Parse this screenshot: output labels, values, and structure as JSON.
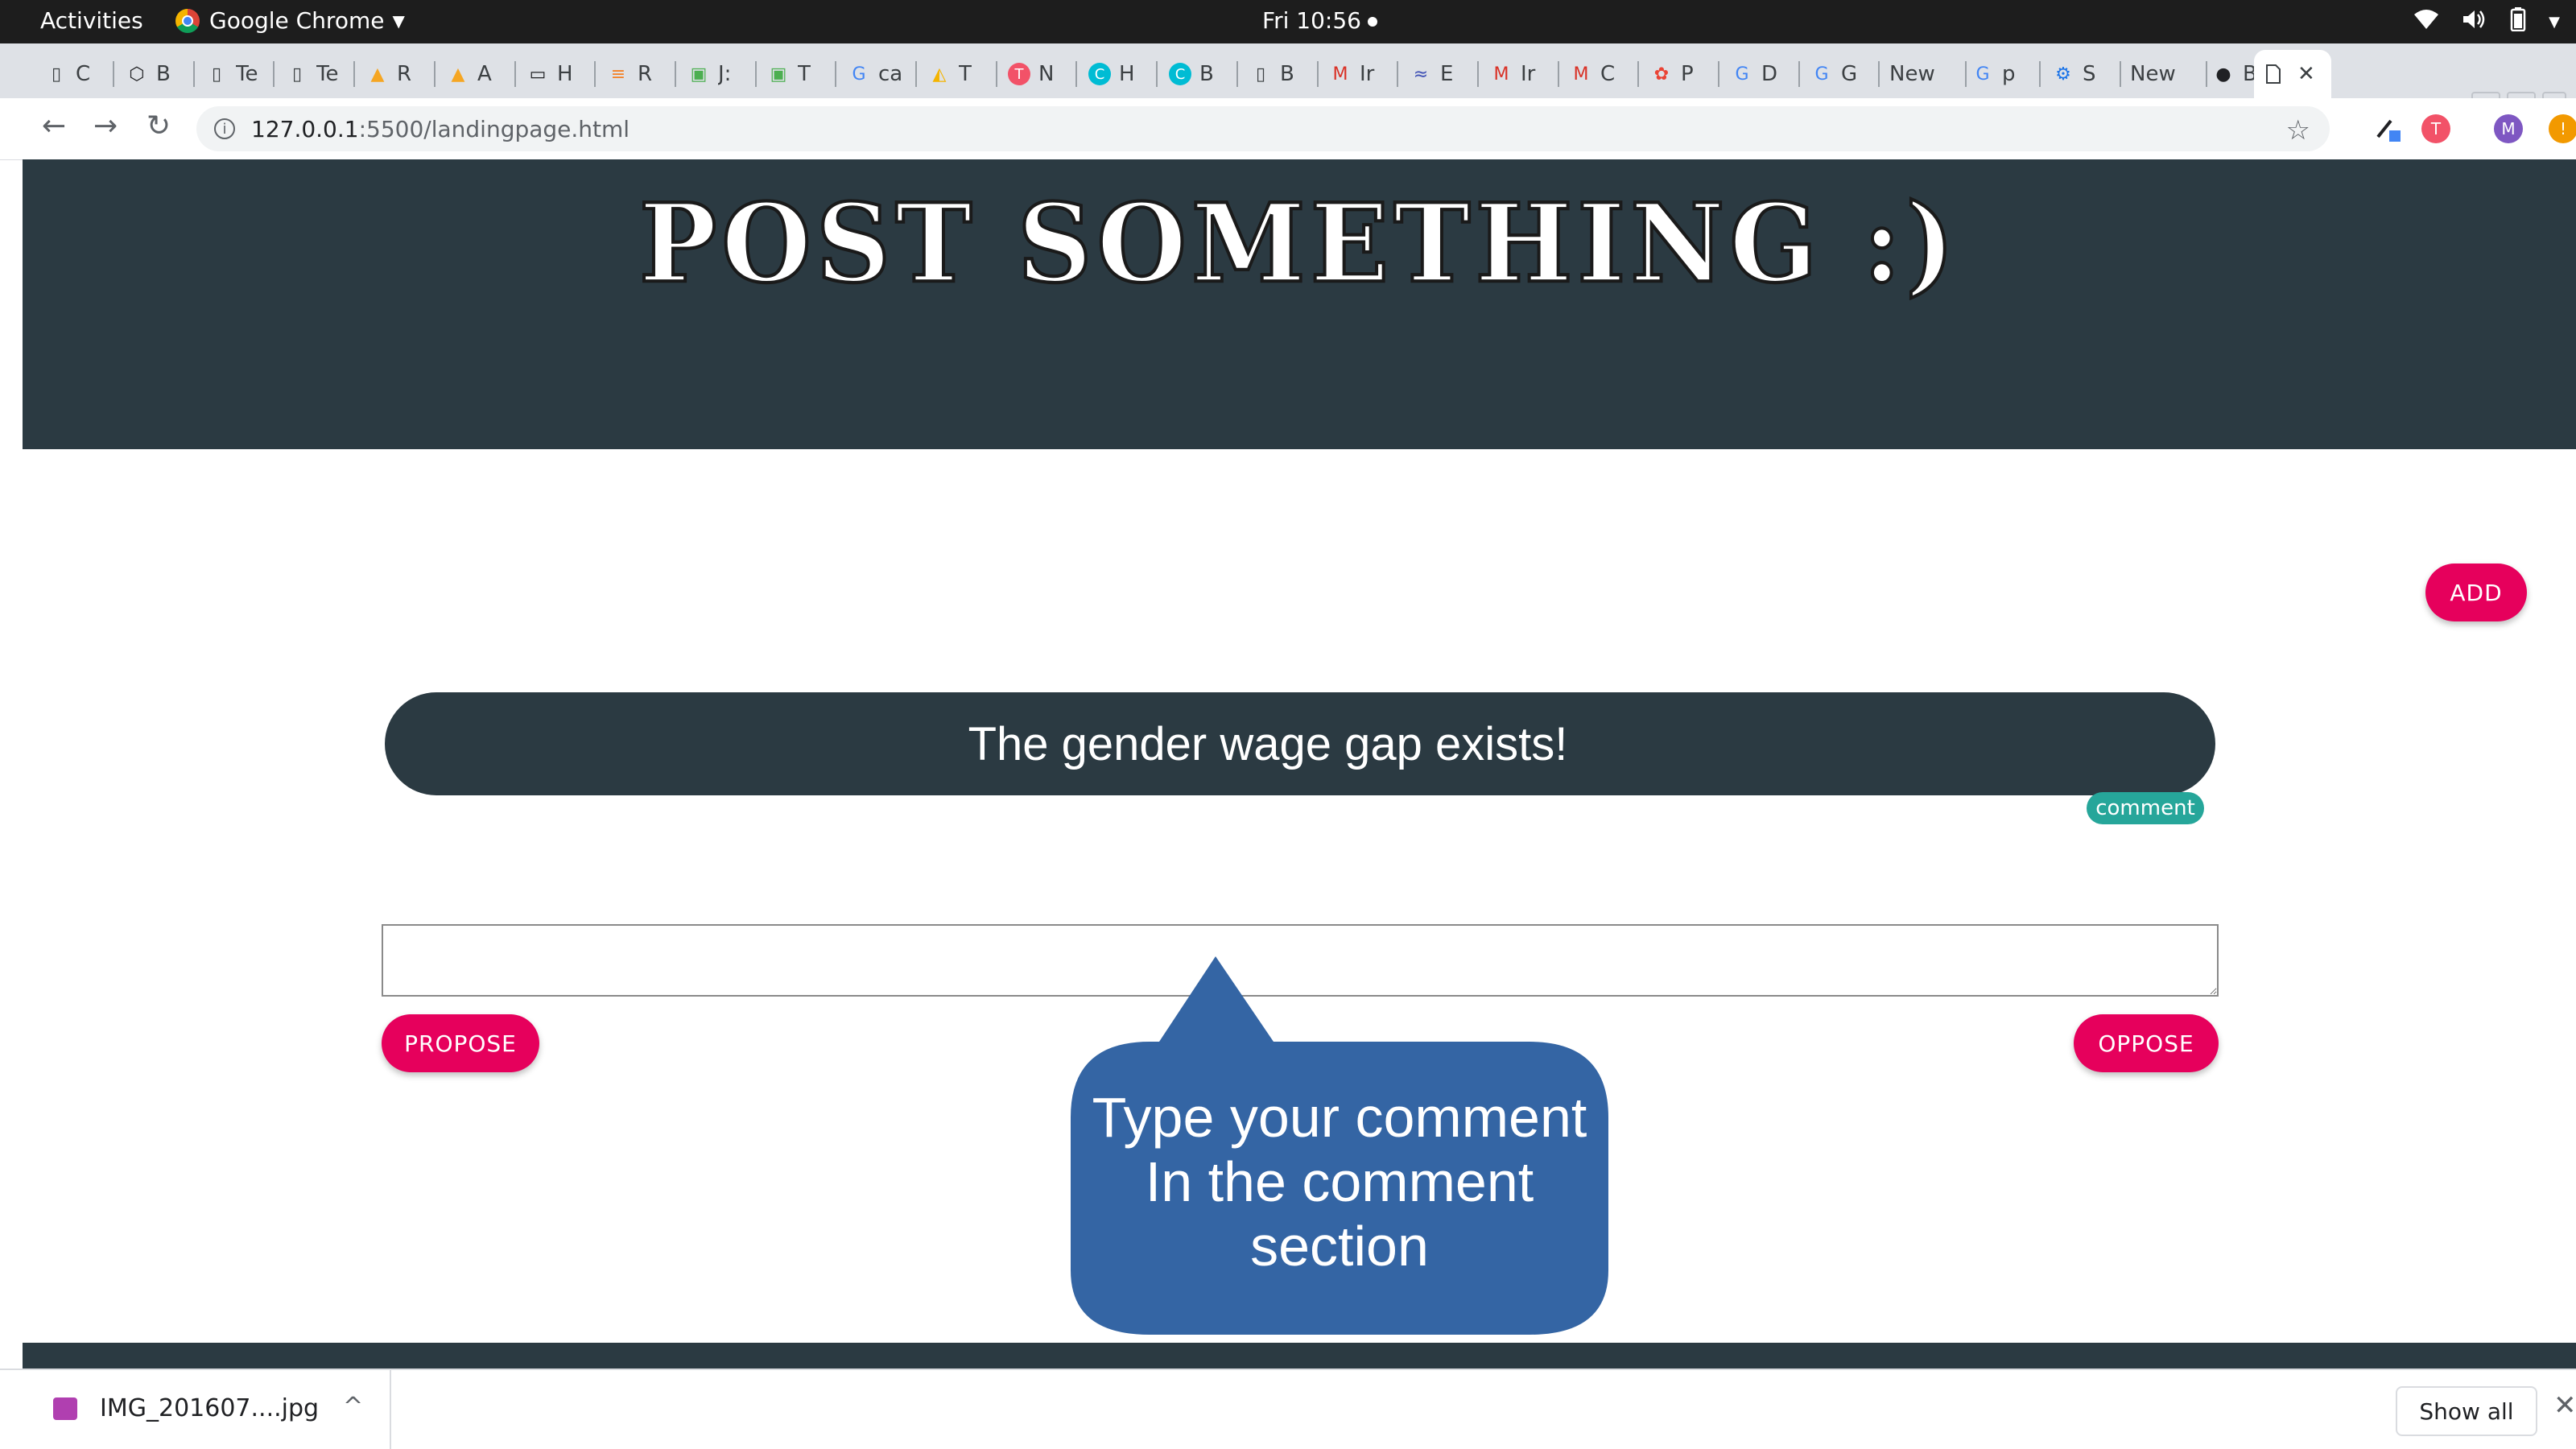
{
  "os_bar": {
    "activities": "Activities",
    "app_name": "Google Chrome",
    "clock": "Fri 10:56"
  },
  "browser": {
    "tabs": [
      {
        "icon": "doc-icon",
        "title": "C"
      },
      {
        "icon": "codepen-icon",
        "title": "B"
      },
      {
        "icon": "doc-icon",
        "title": "Te"
      },
      {
        "icon": "doc-icon",
        "title": "Te"
      },
      {
        "icon": "firebase-icon",
        "title": "R"
      },
      {
        "icon": "firebase-icon",
        "title": "A"
      },
      {
        "icon": "card-icon",
        "title": "H"
      },
      {
        "icon": "stackoverflow-icon",
        "title": "R"
      },
      {
        "icon": "html-icon",
        "title": "J:"
      },
      {
        "icon": "html-icon",
        "title": "T"
      },
      {
        "icon": "google-icon",
        "title": "ca"
      },
      {
        "icon": "drive-icon",
        "title": "T"
      },
      {
        "icon": "t-icon",
        "title": "N"
      },
      {
        "icon": "c-icon",
        "title": "H"
      },
      {
        "icon": "c-icon",
        "title": "B"
      },
      {
        "icon": "doc-icon",
        "title": "B"
      },
      {
        "icon": "gmail-icon",
        "title": "Ir"
      },
      {
        "icon": "wave-icon",
        "title": "E"
      },
      {
        "icon": "gmail-icon",
        "title": "Ir"
      },
      {
        "icon": "gmail-icon",
        "title": "C"
      },
      {
        "icon": "photos-icon",
        "title": "P"
      },
      {
        "icon": "google-icon",
        "title": "D"
      },
      {
        "icon": "google-icon",
        "title": "G"
      },
      {
        "icon": "none",
        "title": "New"
      },
      {
        "icon": "google-icon",
        "title": "p"
      },
      {
        "icon": "gear-icon",
        "title": "S"
      },
      {
        "icon": "none",
        "title": "New"
      },
      {
        "icon": "github-icon",
        "title": "B"
      }
    ],
    "url_host": "127.0.0.1",
    "url_path": ":5500/landingpage.html",
    "profile_initial": "M"
  },
  "page": {
    "title": "POST SOMETHING :)",
    "add_label": "ADD",
    "post_text": "The gender wage gap exists!",
    "comment_chip": "comment",
    "comment_value": "",
    "propose_label": "PROPOSE",
    "oppose_label": "OPPOSE",
    "tooltip_line1": "Type your comment",
    "tooltip_line2": "In the comment",
    "tooltip_line3": "section"
  },
  "downloads": {
    "file_name": "IMG_201607....jpg",
    "show_all": "Show all"
  },
  "colors": {
    "banner": "#2b3a42",
    "accent_pink": "#e6005c",
    "chip_teal": "#26a69a",
    "tooltip_blue": "#3465a4"
  }
}
